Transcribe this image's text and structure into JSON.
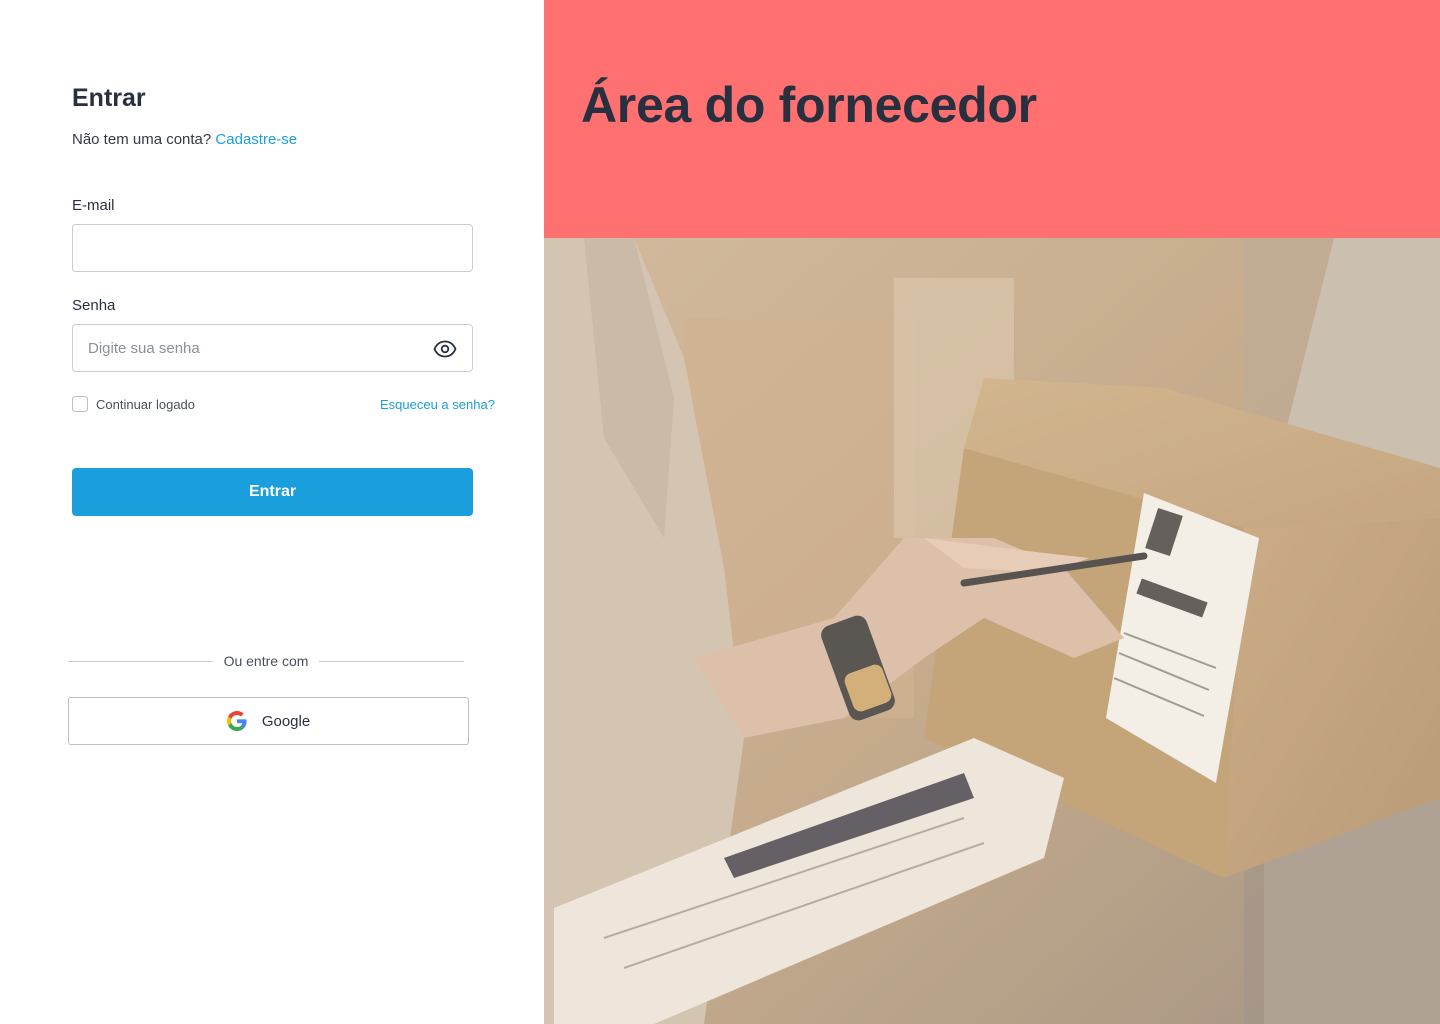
{
  "login": {
    "title": "Entrar",
    "no_account_text": "Não tem uma conta?",
    "signup_link": "Cadastre-se",
    "email_label": "E-mail",
    "email_value": "",
    "password_label": "Senha",
    "password_placeholder": "Digite sua senha",
    "remember_label": "Continuar logado",
    "remember_checked": false,
    "forgot_link": "Esqueceu a senha?",
    "submit_label": "Entrar",
    "divider_text": "Ou entre com",
    "google_label": "Google"
  },
  "hero": {
    "title": "Área do fornecedor",
    "image_description": "photo-delivery-person-signing-package-label"
  },
  "colors": {
    "accent": "#1a9edc",
    "hero_bg": "#ff7171",
    "text_dark": "#283040"
  },
  "icons": {
    "password_toggle": "eye-icon",
    "google": "google-icon"
  }
}
